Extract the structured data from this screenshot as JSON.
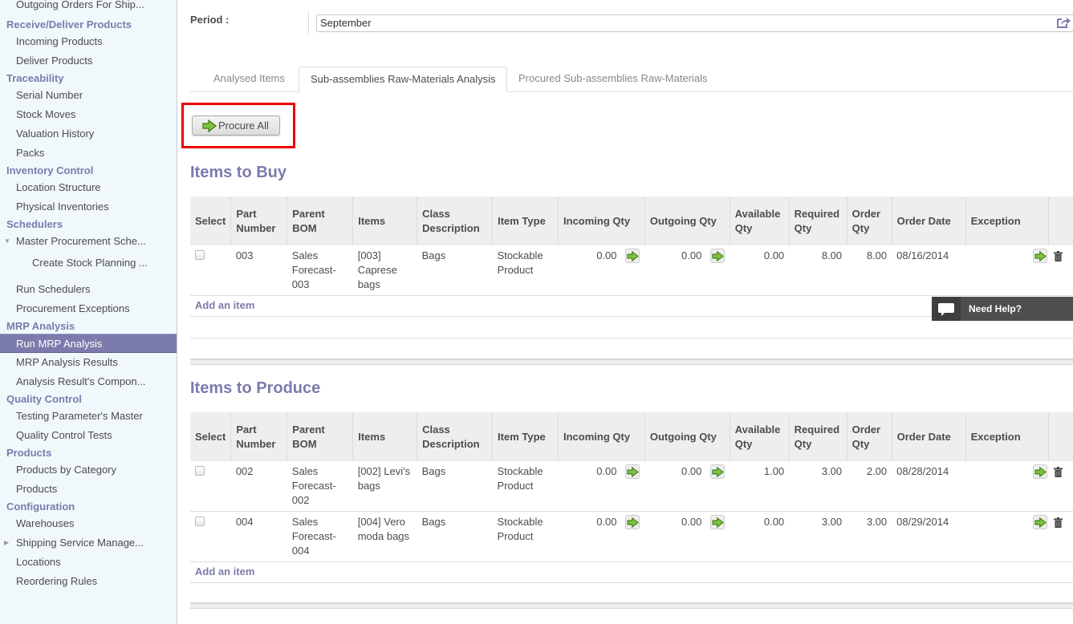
{
  "sidebar": {
    "top_item": "Outgoing Orders For Ship...",
    "sections": [
      {
        "title": "Receive/Deliver Products",
        "items": [
          {
            "label": "Incoming Products"
          },
          {
            "label": "Deliver Products"
          }
        ]
      },
      {
        "title": "Traceability",
        "items": [
          {
            "label": "Serial Number"
          },
          {
            "label": "Stock Moves"
          },
          {
            "label": "Valuation History"
          },
          {
            "label": "Packs"
          }
        ]
      },
      {
        "title": "Inventory Control",
        "items": [
          {
            "label": "Location Structure"
          },
          {
            "label": "Physical Inventories"
          }
        ]
      },
      {
        "title": "Schedulers",
        "items": [
          {
            "label": "Master Procurement Sche..."
          },
          {
            "label": "Create Stock Planning ..."
          },
          {
            "label": "Run Schedulers"
          },
          {
            "label": "Procurement Exceptions"
          }
        ]
      },
      {
        "title": "MRP Analysis",
        "items": [
          {
            "label": "Run MRP Analysis"
          },
          {
            "label": "MRP Analysis Results"
          },
          {
            "label": "Analysis Result's Compon..."
          }
        ]
      },
      {
        "title": "Quality Control",
        "items": [
          {
            "label": "Testing Parameter's Master"
          },
          {
            "label": "Quality Control Tests"
          }
        ]
      },
      {
        "title": "Products",
        "items": [
          {
            "label": "Products by Category"
          },
          {
            "label": "Products"
          }
        ]
      },
      {
        "title": "Configuration",
        "items": [
          {
            "label": "Warehouses"
          },
          {
            "label": "Shipping Service Manage..."
          },
          {
            "label": "Locations"
          },
          {
            "label": "Reordering Rules"
          }
        ]
      }
    ],
    "active_item": "Run MRP Analysis"
  },
  "form": {
    "period_label": "Period :",
    "period_value": "September",
    "period_arrow": "▼"
  },
  "tabs": [
    {
      "label": "Analysed Items",
      "active": false
    },
    {
      "label": "Sub-assemblies Raw-Materials Analysis",
      "active": true
    },
    {
      "label": "Procured Sub-assemblies Raw-Materials",
      "active": false
    }
  ],
  "procure_all_label": "Procure All",
  "columns": [
    "Select",
    "Part Number",
    "Parent BOM",
    "Items",
    "Class Description",
    "Item Type",
    "Incoming Qty",
    "Outgoing Qty",
    "Available Qty",
    "Required Qty",
    "Order Qty",
    "Order Date",
    "Exception"
  ],
  "items_to_buy": {
    "title": "Items to Buy",
    "rows": [
      {
        "part": "003",
        "bom": "Sales Forecast-003",
        "item": "[003] Caprese bags",
        "class": "Bags",
        "type": "Stockable Product",
        "incoming": "0.00",
        "outgoing": "0.00",
        "available": "0.00",
        "required": "8.00",
        "order_qty": "8.00",
        "order_date": "08/16/2014",
        "exception": ""
      }
    ],
    "add_label": "Add an item"
  },
  "items_to_produce": {
    "title": "Items to Produce",
    "rows": [
      {
        "part": "002",
        "bom": "Sales Forecast-002",
        "item": "[002] Levi's bags",
        "class": "Bags",
        "type": "Stockable Product",
        "incoming": "0.00",
        "outgoing": "0.00",
        "available": "1.00",
        "required": "3.00",
        "order_qty": "2.00",
        "order_date": "08/28/2014",
        "exception": ""
      },
      {
        "part": "004",
        "bom": "Sales Forecast-004",
        "item": "[004] Vero moda bags",
        "class": "Bags",
        "type": "Stockable Product",
        "incoming": "0.00",
        "outgoing": "0.00",
        "available": "0.00",
        "required": "3.00",
        "order_qty": "3.00",
        "order_date": "08/29/2014",
        "exception": ""
      }
    ],
    "add_label": "Add an item"
  },
  "help_widget": {
    "label": "Need Help?"
  },
  "colors": {
    "accent": "#7c7bad",
    "highlight": "#ee0000",
    "go_green": "#5aa02c"
  }
}
